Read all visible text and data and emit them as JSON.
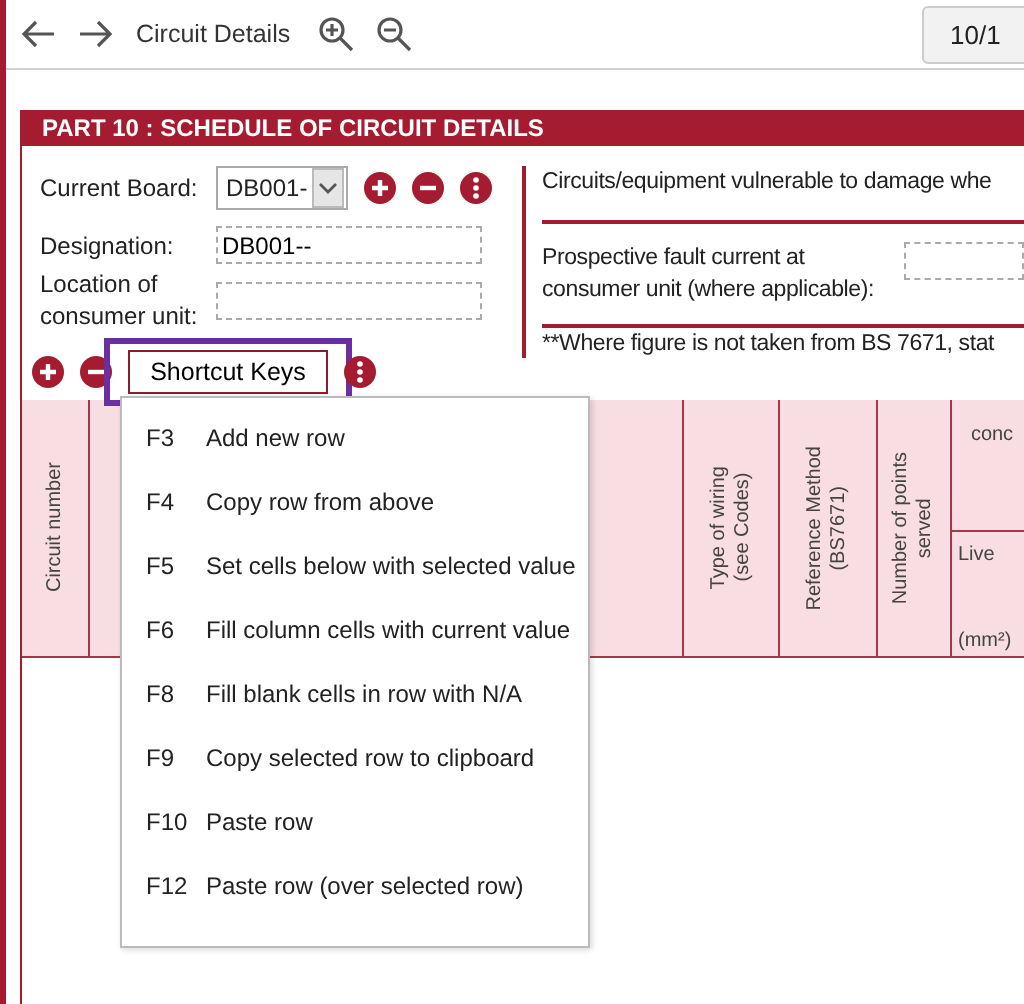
{
  "toolbar": {
    "title": "Circuit Details",
    "page": "10/1"
  },
  "section": {
    "title": "PART 10 : SCHEDULE OF CIRCUIT DETAILS"
  },
  "board_form": {
    "current_board": {
      "label": "Current Board:",
      "value": "DB001-"
    },
    "designation": {
      "label": "Designation:",
      "value": "DB001--"
    },
    "location": {
      "label": "Location of consumer unit:"
    }
  },
  "notes": {
    "vulnerable": "Circuits/equipment vulnerable to damage whe",
    "fault_current_label": "Prospective fault current at consumer unit (where applicable):",
    "footnote": "**Where figure is not taken from BS 7671, stat"
  },
  "shortcut_button": {
    "label": "Shortcut Keys",
    "focused": true
  },
  "table": {
    "columns": [
      {
        "kind": "rotated",
        "lines": [
          "Circuit number"
        ]
      },
      {
        "kind": "blank"
      },
      {
        "kind": "blank"
      },
      {
        "kind": "rotated",
        "lines": [
          "Type of wiring",
          "(see Codes)"
        ]
      },
      {
        "kind": "rotated",
        "lines": [
          "Reference Method",
          "(BS7671)"
        ]
      },
      {
        "kind": "rotated",
        "lines": [
          "Number of points",
          "served"
        ]
      },
      {
        "kind": "group",
        "title": "conc",
        "sub": [
          "Live",
          "(mm²)"
        ]
      }
    ]
  },
  "shortcut_menu": {
    "items": [
      {
        "key": "F3",
        "label": "Add new row"
      },
      {
        "key": "F4",
        "label": "Copy row from above"
      },
      {
        "key": "F5",
        "label": "Set cells below with selected value"
      },
      {
        "key": "F6",
        "label": "Fill column cells with current value"
      },
      {
        "key": "F8",
        "label": "Fill blank cells in row with N/A"
      },
      {
        "key": "F9",
        "label": "Copy selected row to clipboard"
      },
      {
        "key": "F10",
        "label": "Paste row"
      },
      {
        "key": "F12",
        "label": "Paste row (over selected row)"
      }
    ]
  }
}
